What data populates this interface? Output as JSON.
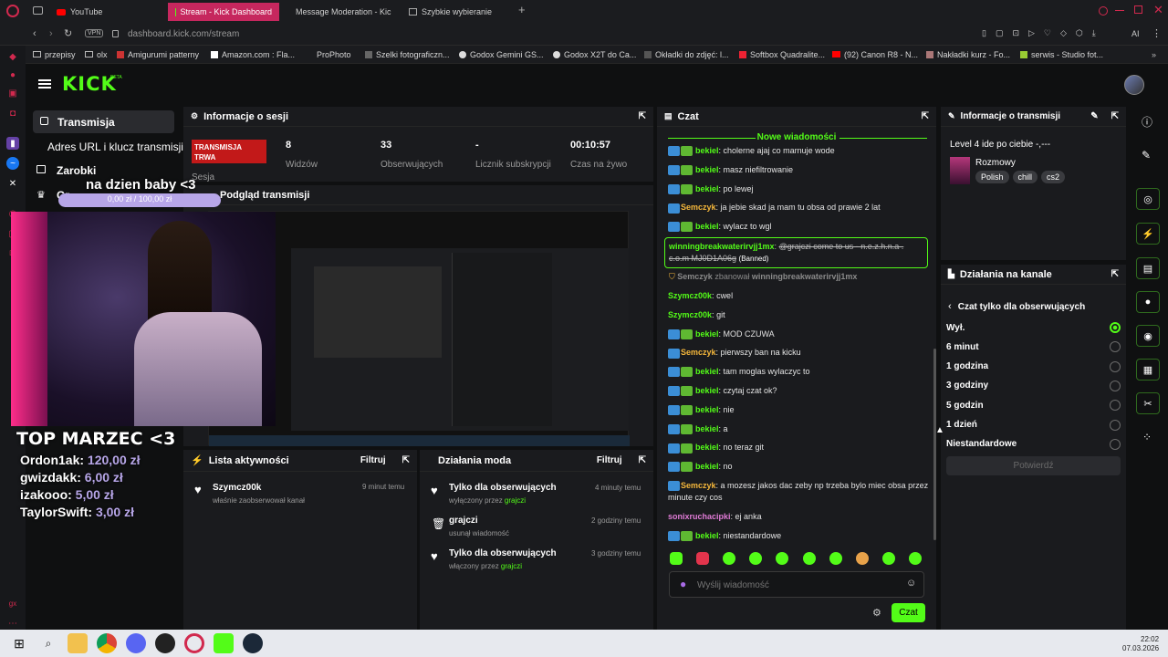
{
  "browser": {
    "tabs": [
      {
        "label": "YouTube",
        "icon": "youtube-icon"
      },
      {
        "label": "Stream - Kick Dashboard",
        "icon": "kick-icon",
        "active": true
      },
      {
        "label": "Message Moderation - Kic",
        "icon": "kick-icon"
      },
      {
        "label": "Szybkie wybieranie",
        "icon": "speed-dial-icon"
      }
    ],
    "url": "dashboard.kick.com/stream",
    "vpn": "VPN",
    "ai_label": "AI",
    "bookmarks": [
      "przepisy",
      "olx",
      "Amigurumi patterny",
      "Amazon.com : Fla...",
      "ProPhoto",
      "Szelki fotograficzn...",
      "Godox Gemini GS...",
      "Godox X2T do Ca...",
      "Okładki do zdjęć: l...",
      "Softbox Quadralite...",
      "(92) Canon R8 - N...",
      "Nakładki kurz - Fo...",
      "serwis - Studio fot..."
    ]
  },
  "kick": {
    "logo": "KICK",
    "logo_beta": "BETA",
    "nav": {
      "transmisja": "Transmisja",
      "adres": "Adres URL i klucz transmisji",
      "zarobki": "Zarobki",
      "partial": "Gr"
    }
  },
  "session": {
    "title": "Informacje o sesji",
    "live_badge": "TRANSMISJA TRWA",
    "live_label": "Sesja",
    "stats": [
      {
        "value": "8",
        "label": "Widzów"
      },
      {
        "value": "33",
        "label": "Obserwujących"
      },
      {
        "value": "-",
        "label": "Licznik subskrypcji"
      },
      {
        "value": "00:10:57",
        "label": "Czas na żywo"
      }
    ]
  },
  "preview": {
    "title": "Podgląd transmisji"
  },
  "overlay": {
    "goal_text": "na dzien baby <3",
    "goal_progress": "0,00 zł / 100,00 zł",
    "goal_fraction": 0.0,
    "top_title": "TOP MARZEC <3",
    "top": [
      {
        "name": "Ordon1ak:",
        "amount": "120,00 zł"
      },
      {
        "name": "gwizdakk:",
        "amount": "6,00 zł"
      },
      {
        "name": "izakooo:",
        "amount": "5,00 zł"
      },
      {
        "name": "TaylorSwift:",
        "amount": "3,00 zł"
      }
    ]
  },
  "activity": {
    "title": "Lista aktywności",
    "filter": "Filtruj",
    "items": [
      {
        "user": "Szymcz00k",
        "text": "właśnie zaobserwował kanał",
        "time": "9 minut temu"
      }
    ]
  },
  "modactions": {
    "title": "Działania moda",
    "filter": "Filtruj",
    "items": [
      {
        "title": "Tylko dla obserwujących",
        "sub": "wyłączony przez",
        "by": "grajczi",
        "time": "4 minuty temu",
        "icon": "heart-icon"
      },
      {
        "title": "grajczi",
        "sub": "usunął wiadomość",
        "by": "",
        "time": "2 godziny temu",
        "icon": "trash-icon"
      },
      {
        "title": "Tylko dla obserwujących",
        "sub": "włączony przez",
        "by": "grajczi",
        "time": "3 godziny temu",
        "icon": "heart-icon"
      }
    ]
  },
  "chat": {
    "title": "Czat",
    "new_messages": "Nowe wiadomości",
    "messages": [
      {
        "user": "bekiel",
        "text": "cholerne ajaj co marnuje wode",
        "color": "#53fc18",
        "badges": 2
      },
      {
        "user": "bekiel",
        "text": "masz niefiltrowanie",
        "color": "#53fc18",
        "badges": 2
      },
      {
        "user": "bekiel",
        "text": "po lewej",
        "color": "#53fc18",
        "badges": 2
      },
      {
        "user": "Semczyk",
        "text": "ja jebie skad ja mam tu obsa od prawie 2 lat",
        "color": "#f5b73b",
        "badges": 1
      },
      {
        "user": "bekiel",
        "text": "wylacz to wgl",
        "color": "#53fc18",
        "badges": 2
      }
    ],
    "banned": {
      "user": "winningbreakwaterirvjj1mx",
      "text": "@grajczi come to us - n.e.z.h.n.a . c.o.m MJ0D1A06g",
      "tag": "(Banned)"
    },
    "ban_notice": {
      "actor": "Semczyk",
      "action": "zbanował",
      "target": "winningbreakwaterirvjj1mx"
    },
    "messages2": [
      {
        "user": "Szymcz00k",
        "text": "cwel",
        "color": "#53fc18",
        "badges": 0
      },
      {
        "user": "Szymcz00k",
        "text": "git",
        "color": "#53fc18",
        "badges": 0
      },
      {
        "user": "bekiel",
        "text": "MOD CZUWA",
        "color": "#53fc18",
        "badges": 2
      },
      {
        "user": "Semczyk",
        "text": "pierwszy ban na kicku",
        "color": "#f5b73b",
        "badges": 1
      },
      {
        "user": "bekiel",
        "text": "tam moglas wylaczyc to",
        "color": "#53fc18",
        "badges": 2
      },
      {
        "user": "bekiel",
        "text": "czytaj czat ok?",
        "color": "#53fc18",
        "badges": 2
      },
      {
        "user": "bekiel",
        "text": "nie",
        "color": "#53fc18",
        "badges": 2
      },
      {
        "user": "bekiel",
        "text": "a",
        "color": "#53fc18",
        "badges": 2
      },
      {
        "user": "bekiel",
        "text": "no teraz git",
        "color": "#53fc18",
        "badges": 2
      },
      {
        "user": "bekiel",
        "text": "no",
        "color": "#53fc18",
        "badges": 2
      },
      {
        "user": "Semczyk",
        "text": "a mozesz jakos dac zeby np trzeba bylo miec obsa przez minute czy cos",
        "color": "#f5b73b",
        "badges": 1
      },
      {
        "user": "sonixruchacipki",
        "text": "ej anka",
        "color": "#e07bd6",
        "badges": 0
      },
      {
        "user": "bekiel",
        "text": "niestandardowe",
        "color": "#53fc18",
        "badges": 2
      }
    ],
    "placeholder": "Wyślij wiadomość",
    "send": "Czat"
  },
  "streaminfo": {
    "title": "Informacje o transmisji",
    "stream_title": "Level 4 ide po ciebie -,---",
    "category": "Rozmowy",
    "tags": [
      "Polish",
      "chill",
      "cs2"
    ]
  },
  "channelactions": {
    "title": "Działania na kanale",
    "back_title": "Czat tylko dla obserwujących",
    "options": [
      "Wył.",
      "6 minut",
      "1 godzina",
      "3 godziny",
      "5 godzin",
      "1 dzień",
      "Niestandardowe"
    ],
    "selected": 0,
    "confirm": "Potwierdź"
  },
  "taskbar": {
    "time": "22:02",
    "date": "07.03.2026"
  }
}
